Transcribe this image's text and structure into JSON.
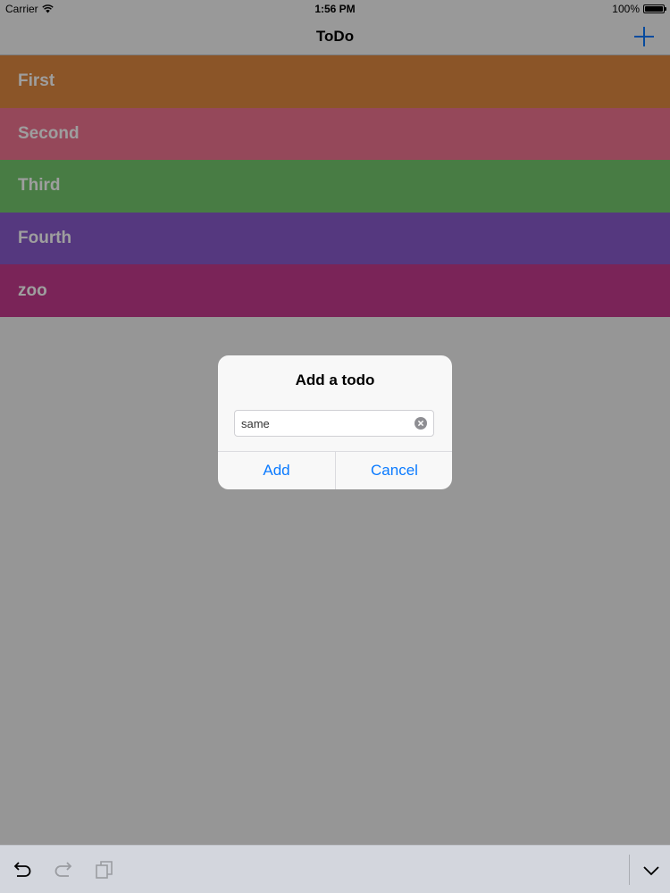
{
  "status_bar": {
    "carrier": "Carrier",
    "time": "1:56 PM",
    "battery": "100%",
    "battery_level": 1.0
  },
  "nav": {
    "title": "ToDo",
    "add_icon": "plus-icon"
  },
  "todos": [
    {
      "label": "First",
      "color": "#e08a41"
    },
    {
      "label": "Second",
      "color": "#f07592"
    },
    {
      "label": "Third",
      "color": "#74c96e"
    },
    {
      "label": "Fourth",
      "color": "#8a5bcd"
    },
    {
      "label": "zoo",
      "color": "#c53b8e"
    }
  ],
  "alert": {
    "title": "Add a todo",
    "input_value": "same",
    "clear_icon": "clear-circle-icon",
    "add_label": "Add",
    "cancel_label": "Cancel"
  },
  "colors": {
    "accent": "#0a7aff",
    "dim": "rgba(0,0,0,0.38)"
  },
  "shortcut_bar": {
    "icons": [
      "undo-icon",
      "redo-icon",
      "paste-icon",
      "keyboard-dismiss-icon"
    ]
  }
}
